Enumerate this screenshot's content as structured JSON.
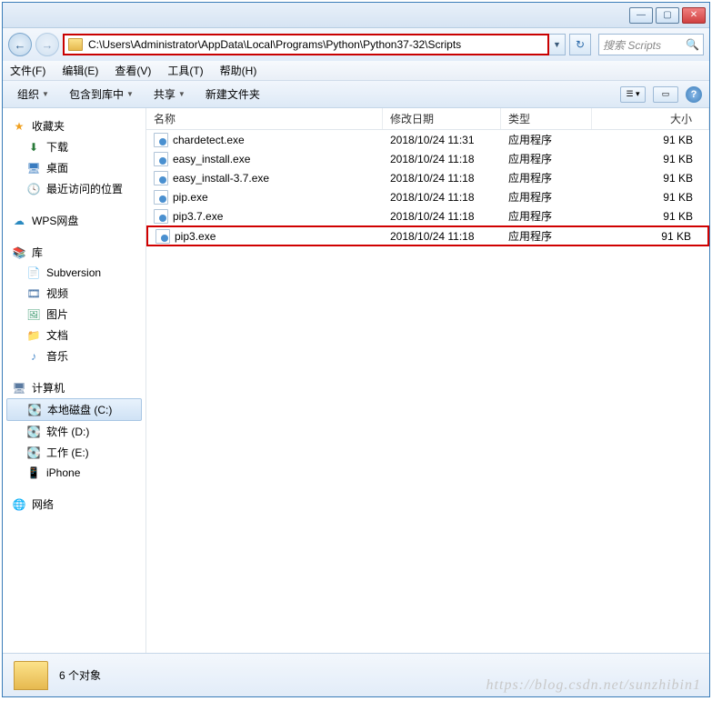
{
  "address_path": "C:\\Users\\Administrator\\AppData\\Local\\Programs\\Python\\Python37-32\\Scripts",
  "search_placeholder": "搜索 Scripts",
  "menu": {
    "file": "文件(F)",
    "edit": "编辑(E)",
    "view": "查看(V)",
    "tools": "工具(T)",
    "help": "帮助(H)"
  },
  "toolbar": {
    "organize": "组织",
    "include": "包含到库中",
    "share": "共享",
    "newfolder": "新建文件夹"
  },
  "columns": {
    "name": "名称",
    "date": "修改日期",
    "type": "类型",
    "size": "大小"
  },
  "sidebar": {
    "favorites": {
      "label": "收藏夹",
      "items": [
        "下载",
        "桌面",
        "最近访问的位置"
      ]
    },
    "wps": {
      "label": "WPS网盘"
    },
    "libraries": {
      "label": "库",
      "items": [
        "Subversion",
        "视频",
        "图片",
        "文档",
        "音乐"
      ]
    },
    "computer": {
      "label": "计算机",
      "items": [
        "本地磁盘 (C:)",
        "软件 (D:)",
        "工作 (E:)",
        "iPhone"
      ]
    },
    "network": {
      "label": "网络"
    }
  },
  "files": [
    {
      "name": "chardetect.exe",
      "date": "2018/10/24 11:31",
      "type": "应用程序",
      "size": "91 KB",
      "hl": false
    },
    {
      "name": "easy_install.exe",
      "date": "2018/10/24 11:18",
      "type": "应用程序",
      "size": "91 KB",
      "hl": false
    },
    {
      "name": "easy_install-3.7.exe",
      "date": "2018/10/24 11:18",
      "type": "应用程序",
      "size": "91 KB",
      "hl": false
    },
    {
      "name": "pip.exe",
      "date": "2018/10/24 11:18",
      "type": "应用程序",
      "size": "91 KB",
      "hl": false
    },
    {
      "name": "pip3.7.exe",
      "date": "2018/10/24 11:18",
      "type": "应用程序",
      "size": "91 KB",
      "hl": false
    },
    {
      "name": "pip3.exe",
      "date": "2018/10/24 11:18",
      "type": "应用程序",
      "size": "91 KB",
      "hl": true
    }
  ],
  "status": {
    "count": "6 个对象"
  },
  "watermark": "https://blog.csdn.net/sunzhibin1"
}
